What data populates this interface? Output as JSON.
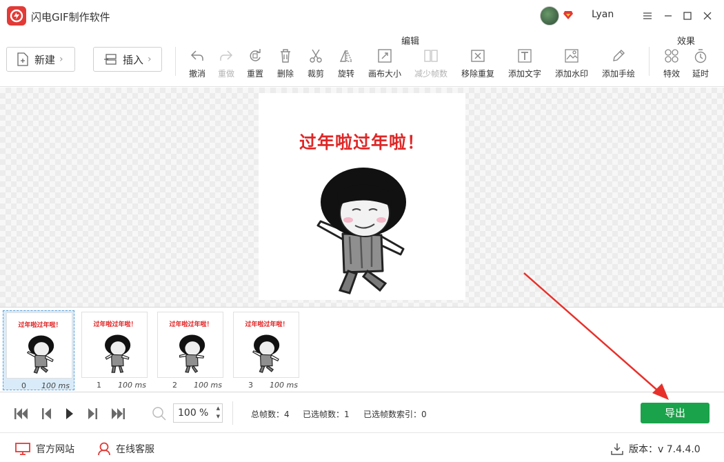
{
  "window": {
    "title": "闪电GIF制作软件",
    "user": "Lyan"
  },
  "toolbar": {
    "new_label": "新建",
    "insert_label": "插入",
    "edit_group_label": "编辑",
    "effects_group_label": "效果",
    "tools": {
      "undo": "撤消",
      "redo": "重做",
      "reset": "重置",
      "delete": "删除",
      "crop": "裁剪",
      "rotate": "旋转",
      "canvas_size": "画布大小",
      "reduce_frames": "减少帧数",
      "remove_duplicates": "移除重复",
      "add_text": "添加文字",
      "add_watermark": "添加水印",
      "add_drawing": "添加手绘",
      "effects": "特效",
      "delay": "延时"
    }
  },
  "preview": {
    "caption": "过年啦过年啦！"
  },
  "timeline": {
    "frames": [
      {
        "index": "0",
        "duration": "100 ms",
        "caption": "过年啦过年啦！"
      },
      {
        "index": "1",
        "duration": "100 ms",
        "caption": "过年啦过年啦！"
      },
      {
        "index": "2",
        "duration": "100 ms",
        "caption": "过年啦过年啦！"
      },
      {
        "index": "3",
        "duration": "100 ms",
        "caption": "过年啦过年啦！"
      }
    ],
    "selected_index": 0
  },
  "playback": {
    "zoom_value": "100",
    "zoom_unit": "%",
    "total_frames": "总帧数：4",
    "selected_frames": "已选帧数：1",
    "selected_index": "已选帧数索引：0",
    "export_label": "导出"
  },
  "footer": {
    "website": "官方网站",
    "support": "在线客服",
    "version": "版本：v 7.4.4.0"
  },
  "colors": {
    "accent": "#1aa34a",
    "brand": "#e23a36",
    "caption": "#e02626",
    "annotation_arrow": "#e8302a"
  }
}
